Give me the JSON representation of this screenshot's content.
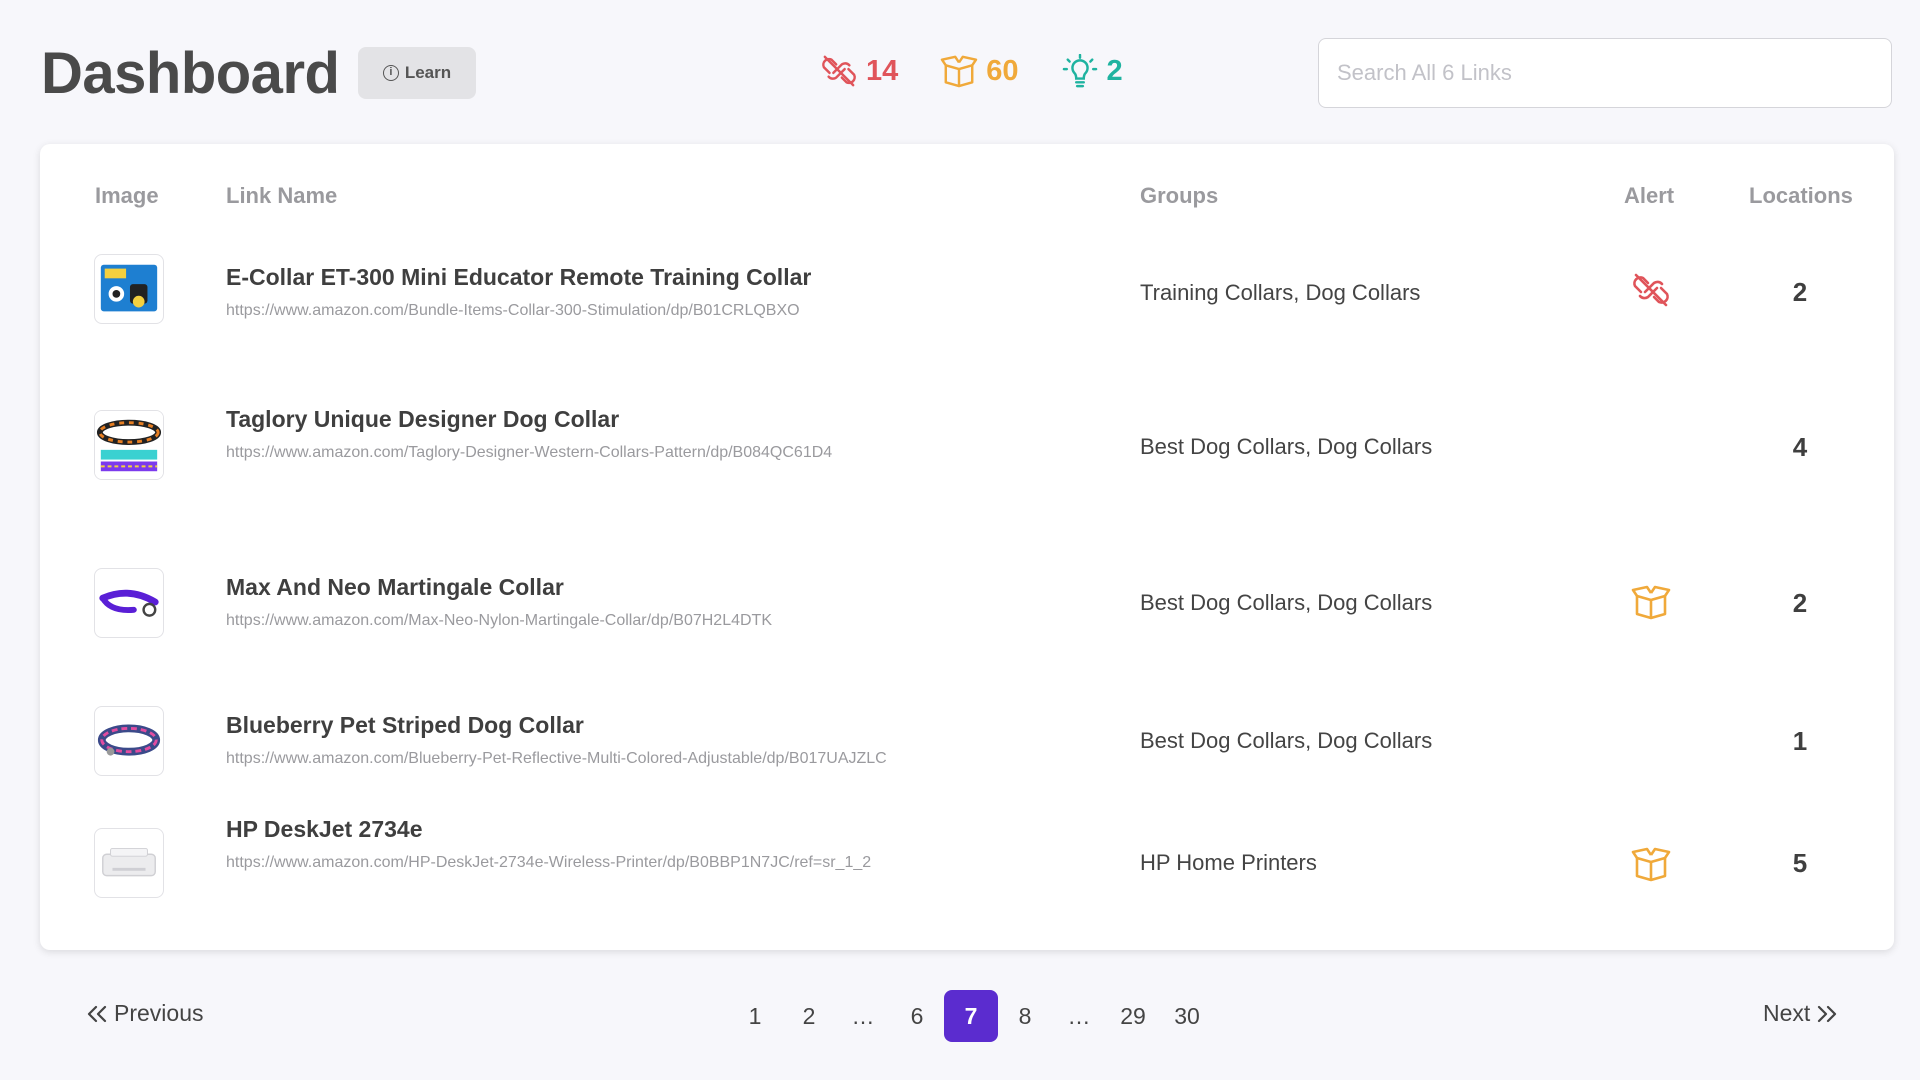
{
  "header": {
    "title": "Dashboard",
    "learn_label": "Learn",
    "search_placeholder": "Search All 6 Links"
  },
  "stats": [
    {
      "icon": "broken-link-icon",
      "value": "14",
      "color": "#e0545a"
    },
    {
      "icon": "open-box-icon",
      "value": "60",
      "color": "#f0a93a"
    },
    {
      "icon": "lightbulb-icon",
      "value": "2",
      "color": "#1fb3a0"
    }
  ],
  "table": {
    "headers": {
      "image": "Image",
      "link_name": "Link Name",
      "groups": "Groups",
      "alert": "Alert",
      "locations": "Locations"
    },
    "rows": [
      {
        "name": "E-Collar ET-300 Mini Educator Remote Training Collar",
        "url": "https://www.amazon.com/Bundle-Items-Collar-300-Stimulation/dp/B01CRLQBXO",
        "groups": "Training Collars, Dog Collars",
        "alert": "broken-link-icon",
        "locations": "2"
      },
      {
        "name": "Taglory Unique Designer Dog Collar",
        "url": "https://www.amazon.com/Taglory-Designer-Western-Collars-Pattern/dp/B084QC61D4",
        "groups": "Best Dog Collars, Dog Collars",
        "alert": "",
        "locations": "4"
      },
      {
        "name": "Max And Neo Martingale Collar",
        "url": "https://www.amazon.com/Max-Neo-Nylon-Martingale-Collar/dp/B07H2L4DTK",
        "groups": "Best Dog Collars, Dog Collars",
        "alert": "open-box-icon",
        "locations": "2"
      },
      {
        "name": "Blueberry Pet Striped Dog Collar",
        "url": "https://www.amazon.com/Blueberry-Pet-Reflective-Multi-Colored-Adjustable/dp/B017UAJZLC",
        "groups": "Best Dog Collars, Dog Collars",
        "alert": "",
        "locations": "1"
      },
      {
        "name": "HP DeskJet 2734e",
        "url": "https://www.amazon.com/HP-DeskJet-2734e-Wireless-Printer/dp/B0BBP1N7JC/ref=sr_1_2",
        "groups": "HP Home Printers",
        "alert": "open-box-icon",
        "locations": "5"
      }
    ]
  },
  "pagination": {
    "previous_label": "Previous",
    "next_label": "Next",
    "pages": [
      "1",
      "2",
      "…",
      "6",
      "7",
      "8",
      "…",
      "29",
      "30"
    ],
    "current": "7",
    "accent": "#5b2ccf"
  }
}
